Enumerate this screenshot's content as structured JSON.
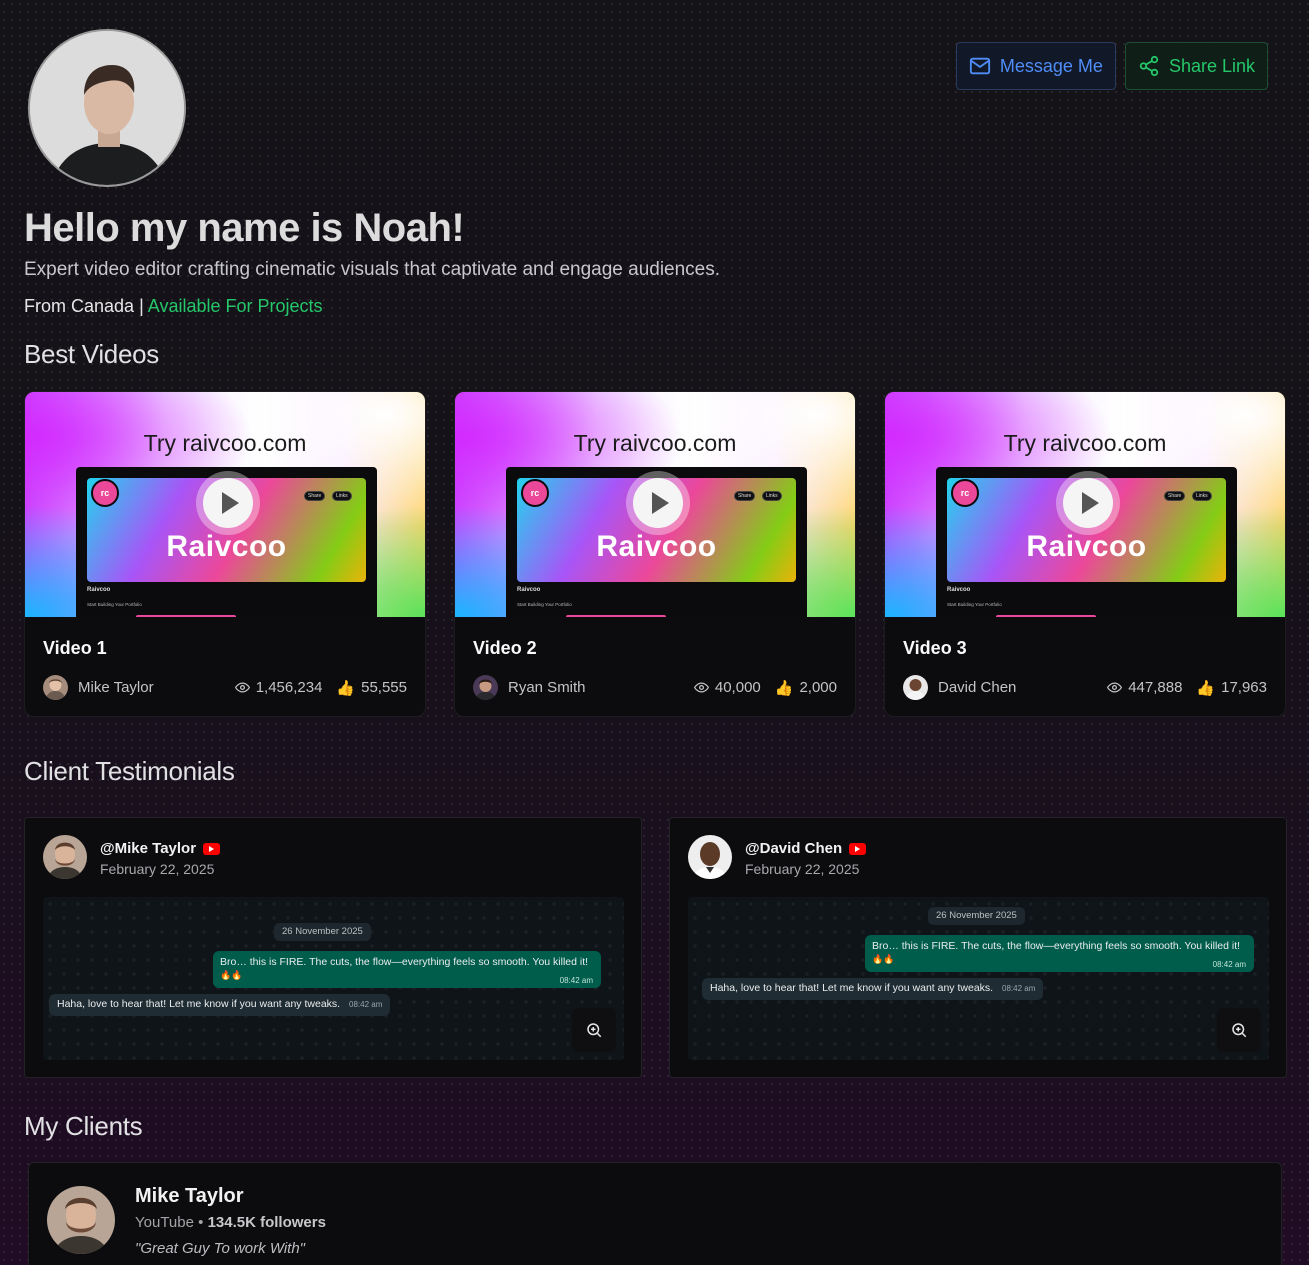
{
  "profile": {
    "name_heading": "Hello my name is Noah!",
    "tagline": "Expert video editor crafting cinematic visuals that captivate and engage audiences.",
    "from": "From Canada",
    "separator": "|",
    "availability": "Available For Projects"
  },
  "actions": {
    "message_label": "Message Me",
    "share_label": "Share Link"
  },
  "sections": {
    "videos": "Best Videos",
    "testimonials": "Client Testimonials",
    "clients": "My Clients"
  },
  "videos": [
    {
      "title": "Video 1",
      "creator": "Mike Taylor",
      "views": "1,456,234",
      "likes": "55,555",
      "thumb_caption": "Try raivcoo.com",
      "brand_word": "Raivcoo",
      "logo_text": "rc"
    },
    {
      "title": "Video 2",
      "creator": "Ryan Smith",
      "views": "40,000",
      "likes": "2,000",
      "thumb_caption": "Try raivcoo.com",
      "brand_word": "Raivcoo",
      "logo_text": "rc"
    },
    {
      "title": "Video 3",
      "creator": "David Chen",
      "views": "447,888",
      "likes": "17,963",
      "thumb_caption": "Try raivcoo.com",
      "brand_word": "Raivcoo",
      "logo_text": "rc"
    }
  ],
  "testimonials": [
    {
      "handle": "@Mike Taylor",
      "date": "February 22, 2025",
      "chat_date": "26 November 2025",
      "client_msg": "Bro… this is FIRE. The cuts, the flow—everything feels so smooth. You killed it!",
      "client_emoji": "🔥🔥",
      "client_time": "08:42 am",
      "reply_msg": "Haha, love to hear that! Let me know if you want any tweaks.",
      "reply_time": "08:42 am"
    },
    {
      "handle": "@David Chen",
      "date": "February 22, 2025",
      "chat_date": "26 November 2025",
      "client_msg": "Bro… this is FIRE. The cuts, the flow—everything feels so smooth. You killed it!",
      "client_emoji": "🔥🔥",
      "client_time": "08:42 am",
      "reply_msg": "Haha, love to hear that! Let me know if you want any tweaks.",
      "reply_time": "08:42 am"
    }
  ],
  "clients": [
    {
      "name": "Mike Taylor",
      "platform": "YouTube",
      "dot": "•",
      "followers": "134.5K followers",
      "quote": "\"Great Guy To work With\""
    }
  ],
  "mock_preview": {
    "share": "Share",
    "links": "Links",
    "title": "Raivcoo",
    "subtitle": "Start Building Your Portfolio"
  },
  "icons": {
    "message": "mail-icon",
    "share": "share-icon",
    "views": "eye-icon",
    "likes": "thumbs-up-icon",
    "zoom": "zoom-in-icon",
    "platform": "youtube-icon"
  },
  "colors": {
    "accent_blue": "#4f8df7",
    "accent_green": "#25c76a",
    "whatsapp_out": "#005c4b",
    "youtube_red": "#ff0000"
  }
}
